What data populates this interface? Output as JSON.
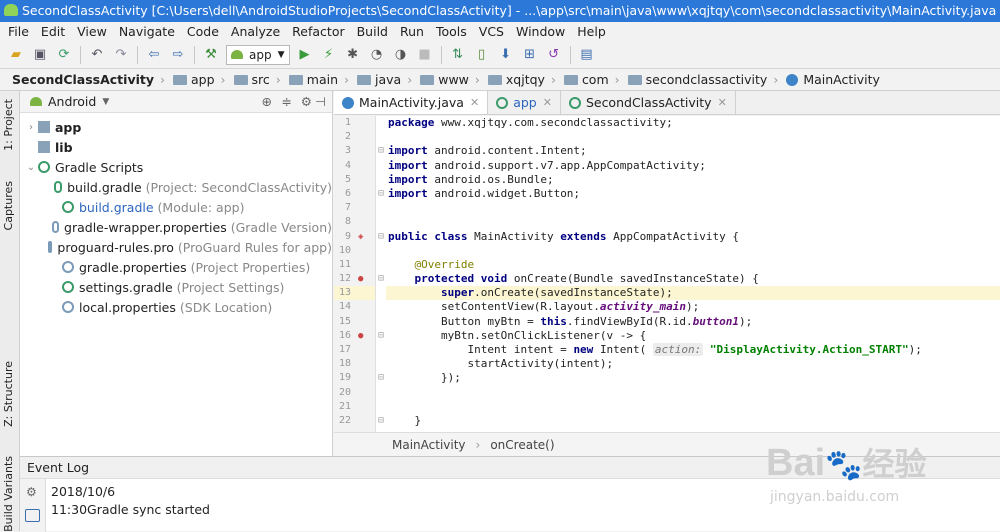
{
  "window": {
    "title": "SecondClassActivity [C:\\Users\\dell\\AndroidStudioProjects\\SecondClassActivity] - ...\\app\\src\\main\\java\\www\\xqjtqy\\com\\secondclassactivity\\MainActivity.java [app] - Android Studio"
  },
  "menu": [
    "File",
    "Edit",
    "View",
    "Navigate",
    "Code",
    "Analyze",
    "Refactor",
    "Build",
    "Run",
    "Tools",
    "VCS",
    "Window",
    "Help"
  ],
  "toolbar": {
    "run_config": "app"
  },
  "navbar": [
    "SecondClassActivity",
    "app",
    "src",
    "main",
    "java",
    "www",
    "xqjtqy",
    "com",
    "secondclassactivity",
    "MainActivity"
  ],
  "sidebar_tabs": {
    "project": "1: Project",
    "captures": "Captures",
    "structure": "Z: Structure",
    "build_variants": "Build Variants"
  },
  "project": {
    "view": "Android",
    "tree": [
      {
        "indent": 0,
        "arrow": "›",
        "name": "app",
        "bold": true,
        "hint": ""
      },
      {
        "indent": 0,
        "arrow": "",
        "name": "lib",
        "bold": true,
        "hint": ""
      },
      {
        "indent": 0,
        "arrow": "⌄",
        "name": "Gradle Scripts",
        "bold": false,
        "hint": ""
      },
      {
        "indent": 1,
        "arrow": "",
        "name": "build.gradle",
        "bold": false,
        "hint": "(Project: SecondClassActivity)"
      },
      {
        "indent": 1,
        "arrow": "",
        "name": "build.gradle",
        "bold": false,
        "hint": "(Module: app)",
        "link": true
      },
      {
        "indent": 1,
        "arrow": "",
        "name": "gradle-wrapper.properties",
        "bold": false,
        "hint": "(Gradle Version)"
      },
      {
        "indent": 1,
        "arrow": "",
        "name": "proguard-rules.pro",
        "bold": false,
        "hint": "(ProGuard Rules for app)"
      },
      {
        "indent": 1,
        "arrow": "",
        "name": "gradle.properties",
        "bold": false,
        "hint": "(Project Properties)"
      },
      {
        "indent": 1,
        "arrow": "",
        "name": "settings.gradle",
        "bold": false,
        "hint": "(Project Settings)"
      },
      {
        "indent": 1,
        "arrow": "",
        "name": "local.properties",
        "bold": false,
        "hint": "(SDK Location)"
      }
    ]
  },
  "tabs": [
    {
      "label": "MainActivity.java",
      "active": true
    },
    {
      "label": "app",
      "active": false
    },
    {
      "label": "SecondClassActivity",
      "active": false
    }
  ],
  "code": [
    {
      "n": 1,
      "t": [
        [
          "kw",
          "package "
        ],
        [
          "",
          "www.xqjtqy.com.secondclassactivity;"
        ]
      ]
    },
    {
      "n": 2,
      "t": []
    },
    {
      "n": 3,
      "t": [
        [
          "kw",
          "import "
        ],
        [
          "",
          "android.content.Intent;"
        ]
      ]
    },
    {
      "n": 4,
      "t": [
        [
          "kw",
          "import "
        ],
        [
          "",
          "android.support.v7.app.AppCompatActivity;"
        ]
      ]
    },
    {
      "n": 5,
      "t": [
        [
          "kw",
          "import "
        ],
        [
          "",
          "android.os.Bundle;"
        ]
      ]
    },
    {
      "n": 6,
      "t": [
        [
          "kw",
          "import "
        ],
        [
          "",
          "android.widget.Button;"
        ]
      ]
    },
    {
      "n": 7,
      "t": []
    },
    {
      "n": 8,
      "t": []
    },
    {
      "n": 9,
      "t": [
        [
          "kw",
          "public class "
        ],
        [
          "",
          "MainActivity "
        ],
        [
          "kw",
          "extends "
        ],
        [
          "",
          "AppCompatActivity {"
        ]
      ]
    },
    {
      "n": 10,
      "t": []
    },
    {
      "n": 11,
      "t": [
        [
          "",
          "    "
        ],
        [
          "an",
          "@Override"
        ]
      ]
    },
    {
      "n": 12,
      "t": [
        [
          "",
          "    "
        ],
        [
          "kw",
          "protected void "
        ],
        [
          "",
          "onCreate(Bundle savedInstanceState) {"
        ]
      ]
    },
    {
      "n": 13,
      "t": [
        [
          "",
          "        "
        ],
        [
          "kw",
          "super"
        ],
        [
          "",
          ".onCreate(savedInstanceState);"
        ]
      ],
      "hl": true
    },
    {
      "n": 14,
      "t": [
        [
          "",
          "        setContentView(R.layout."
        ],
        [
          "it",
          "activity_main"
        ],
        [
          "",
          ");"
        ]
      ]
    },
    {
      "n": 15,
      "t": [
        [
          "",
          "        Button myBtn = "
        ],
        [
          "kw",
          "this"
        ],
        [
          "",
          ".findViewById(R.id."
        ],
        [
          "it",
          "button1"
        ],
        [
          "",
          ");"
        ]
      ]
    },
    {
      "n": 16,
      "t": [
        [
          "",
          "        myBtn.setOnClickListener(v -> {"
        ]
      ]
    },
    {
      "n": 17,
      "t": [
        [
          "",
          "            Intent intent = "
        ],
        [
          "kw",
          "new "
        ],
        [
          "",
          "Intent( "
        ],
        [
          "hint",
          "action:"
        ],
        [
          "st",
          " \"DisplayActivity.Action_START\""
        ],
        [
          "",
          ");"
        ]
      ]
    },
    {
      "n": 18,
      "t": [
        [
          "",
          "            startActivity(intent);"
        ]
      ]
    },
    {
      "n": 19,
      "t": [
        [
          "",
          "        });"
        ]
      ]
    },
    {
      "n": 20,
      "t": []
    },
    {
      "n": 21,
      "t": []
    },
    {
      "n": 22,
      "t": [
        [
          "",
          "    }"
        ]
      ]
    }
  ],
  "editor_breadcrumb": [
    "MainActivity",
    "onCreate()"
  ],
  "event_log": {
    "title": "Event Log",
    "date": "2018/10/6",
    "message": "11:30Gradle sync started"
  },
  "watermark": {
    "brand": "Bai",
    "cn": "经验",
    "url": "jingyan.baidu.com"
  }
}
